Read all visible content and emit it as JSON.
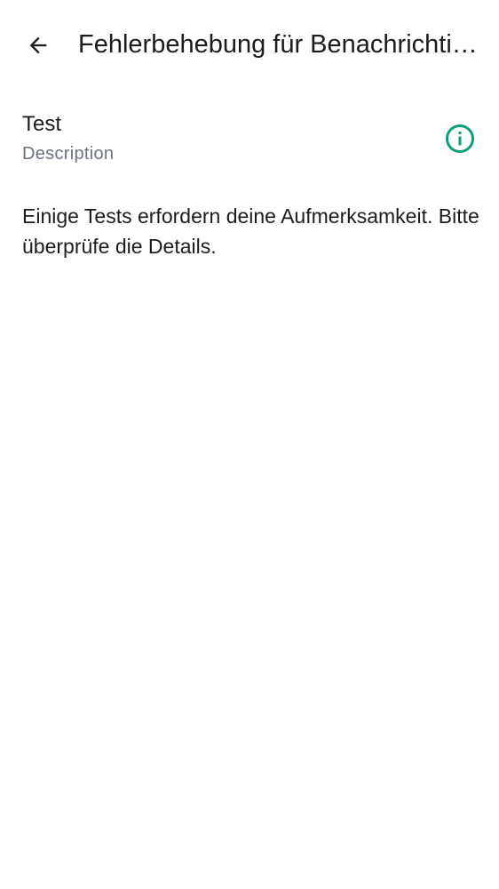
{
  "header": {
    "title": "Fehlerbehebung für Benachrichtigungen",
    "back_icon": "arrow-back-icon"
  },
  "test_item": {
    "title": "Test",
    "description": "Description",
    "status_icon": "info-icon",
    "status_color": "#0f9d7a"
  },
  "message": {
    "text": "Einige Tests erfordern deine Aufmerksamkeit. Bitte überprüfe die Details."
  }
}
